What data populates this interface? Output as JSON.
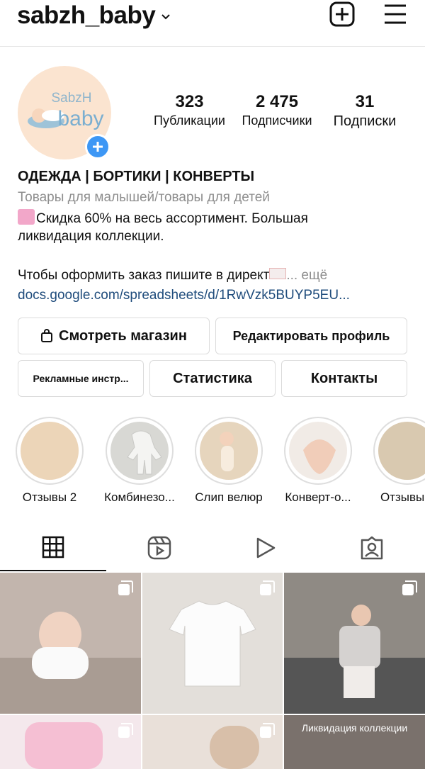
{
  "header": {
    "username": "sabzh_baby"
  },
  "avatar": {
    "line1": "SabzH",
    "line2": "baby"
  },
  "stats": [
    {
      "value": "323",
      "label": "Публикации"
    },
    {
      "value": "2 475",
      "label": "Подписчики"
    },
    {
      "value": "31",
      "label": "Подписки"
    }
  ],
  "bio": {
    "name": "ОДЕЖДА | БОРТИКИ | КОНВЕРТЫ",
    "category": "Товары для малышей/товары для детей",
    "line1": "Скидка 60% на весь ассортимент. Большая",
    "line2": "ликвидация коллекции.",
    "line3": "Чтобы оформить заказ пишите в директ",
    "more": "... ещё",
    "link": "docs.google.com/spreadsheets/d/1RwVzk5BUYP5EU..."
  },
  "buttons": {
    "shop": "Смотреть магазин",
    "edit": "Редактировать профиль",
    "ads": "Рекламные инстр...",
    "stats": "Статистика",
    "contacts": "Контакты"
  },
  "highlights": [
    {
      "label": "Отзывы 2"
    },
    {
      "label": "Комбинезо..."
    },
    {
      "label": "Слип велюр"
    },
    {
      "label": "Конверт-о..."
    },
    {
      "label": "Отзывы"
    }
  ],
  "grid": {
    "caption": "Ликвидация коллекции"
  },
  "colors": {
    "accent": "#3d97f5",
    "link": "#1f4c7c",
    "muted": "#8e8e8e",
    "border": "#dbdbdb"
  }
}
